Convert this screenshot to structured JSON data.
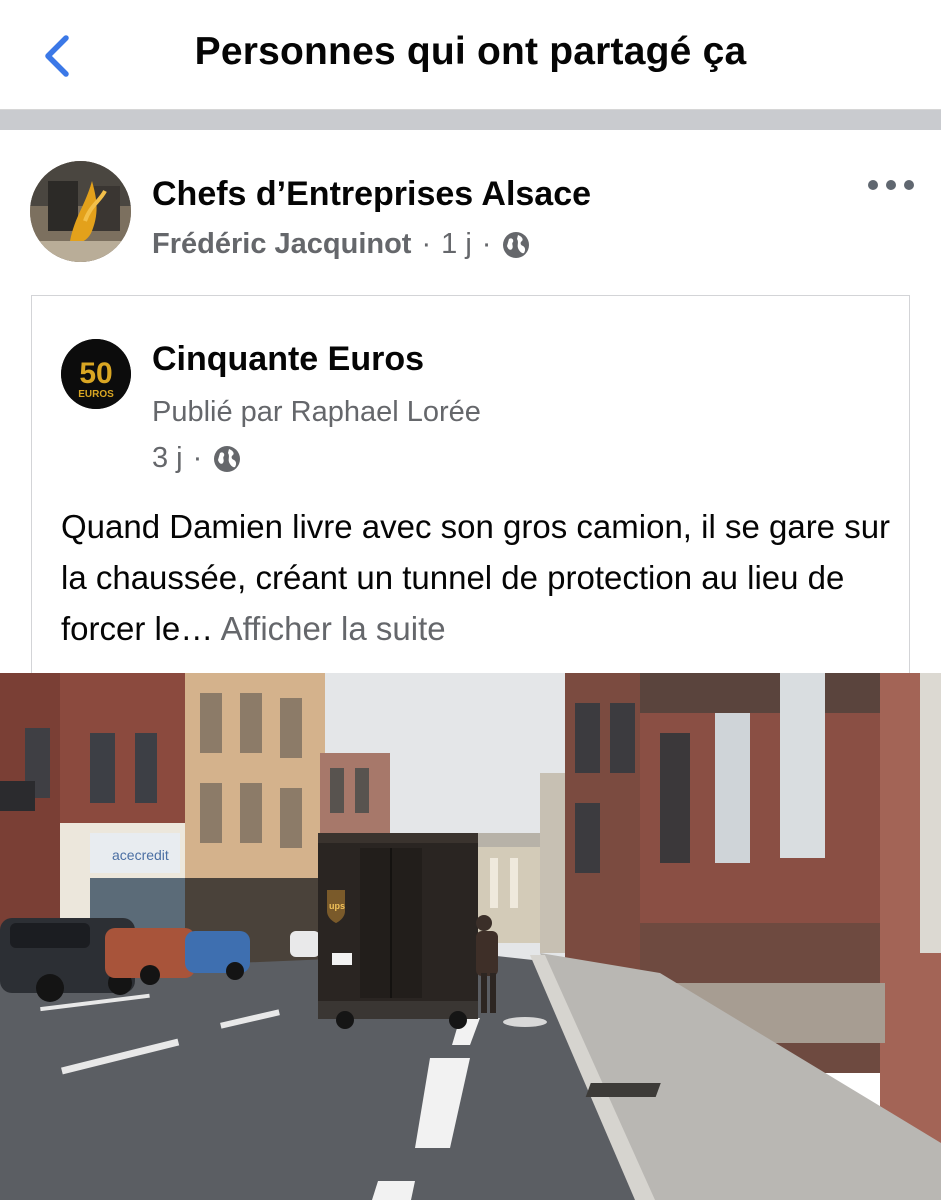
{
  "header": {
    "title": "Personnes qui ont partagé ça",
    "back_icon": "chevron-left-icon",
    "accent_color": "#3b78e7"
  },
  "post": {
    "group_name": "Chefs d’Entreprises Alsace",
    "author": "Frédéric Jacquinot",
    "separator": "·",
    "time": "1 j",
    "privacy_icon": "globe-icon",
    "more_icon": "more-horizontal-icon",
    "shared": {
      "page_name": "Cinquante Euros",
      "avatar_text": "50",
      "avatar_subtext": "EUROS",
      "byline": "Publié par Raphael Lorée",
      "time": "3 j",
      "separator": "·",
      "body": "Quand Damien livre avec son gros camion, il se gare sur la chaussée, créant un tunnel de protection au lieu de forcer le…",
      "see_more": "Afficher la suite"
    },
    "photo": {
      "sign_text": "acecredit",
      "truck_logo": "ups"
    }
  }
}
